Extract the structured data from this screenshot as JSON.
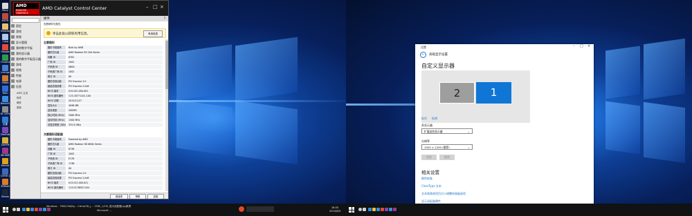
{
  "desktop": {
    "icons": [
      {
        "label": "Recy",
        "color": "#d9d9d9"
      },
      {
        "label": "MSTR",
        "color": "#c04a3a"
      },
      {
        "label": "Desktop",
        "color": "#e6c36a"
      },
      {
        "label": "1.jpg",
        "color": "#b0c8e8"
      },
      {
        "label": "Google",
        "color": "#e24a3b"
      },
      {
        "label": "Chrome",
        "color": "#2f9b4a"
      },
      {
        "label": "Livings",
        "color": "#4a7fd1"
      },
      {
        "label": "Video",
        "color": "#d37a2d"
      },
      {
        "label": "YoKu",
        "color": "#2f6fd0"
      },
      {
        "label": "BaiduYun",
        "color": "#3a8fe0"
      },
      {
        "label": "Kt 10Px",
        "color": "#909090"
      },
      {
        "label": "迅雷",
        "color": "#2e7fd6"
      },
      {
        "label": "DesPub",
        "color": "#7c4ab8"
      },
      {
        "label": "ZoeYM",
        "color": "#d6b23a"
      },
      {
        "label": "WinRAR",
        "color": "#9c3a8a"
      },
      {
        "label": "Marvel",
        "color": "#e0a020"
      },
      {
        "label": "CEFW 2015",
        "color": "#3a6ab8"
      },
      {
        "label": "3DMark",
        "color": "#e07a20"
      },
      {
        "label": "Steam",
        "color": "#1b2838"
      }
    ]
  },
  "amd": {
    "title": "AMD Catalyst Control Center",
    "logo_top": "AMD",
    "logo_sub": "RADEON GRAPHICS",
    "search_placeholder": "",
    "nav": [
      "固定",
      "游戏",
      "视频",
      "显卡管理",
      "我的数字平板",
      "我的显示器",
      "我的数字平板显示器",
      "游戏",
      "视频",
      "性能",
      "电源",
      "信息"
    ],
    "nav_sub": [
      "AMD 主页",
      "软件",
      "硬件",
      "更新"
    ],
    "header": "硬件",
    "hint": "查看硬件的属性",
    "warning": "单击此处以获取有用信息。",
    "warning_button": "有用信息",
    "section1": "主要图形",
    "table1": [
      {
        "k": "图形卡制造商",
        "v": "Built by AMD"
      },
      {
        "k": "图形芯片组",
        "v": "AMD Radeon R9 200 Series"
      },
      {
        "k": "设备 ID",
        "v": "6781"
      },
      {
        "k": "厂商 ID",
        "v": "1002"
      },
      {
        "k": "子系统 ID",
        "v": "0B00"
      },
      {
        "k": "子系统厂商 ID",
        "v": "1002"
      },
      {
        "k": "修订 ID",
        "v": "00"
      },
      {
        "k": "图形总线功能",
        "v": "PCI Express 3.0"
      },
      {
        "k": "最高总线设置",
        "v": "PCI Express 2.0x8"
      },
      {
        "k": "BIOS 版本",
        "v": "015.041.000.001"
      },
      {
        "k": "BIOS 部件编号",
        "v": "113-C6771101-100"
      },
      {
        "k": "BIOS 日期",
        "v": "2013/11/27"
      },
      {
        "k": "显存大小",
        "v": "4096 MB"
      },
      {
        "k": "显存类型",
        "v": "GDDR5"
      },
      {
        "k": "核心时钟 (MHz)",
        "v": "1080 MHz"
      },
      {
        "k": "显存时钟 (MHz)",
        "v": "1300 MHz"
      },
      {
        "k": "总显存带宽 (GB/s)",
        "v": "332.8 GB/s"
      }
    ],
    "section2": "次要图形适配器",
    "table2": [
      {
        "k": "图形卡制造商",
        "v": "Powered by AMD"
      },
      {
        "k": "图形芯片组",
        "v": "AMD Radeon HD 6800 Series"
      },
      {
        "k": "设备 ID",
        "v": "6738"
      },
      {
        "k": "厂商 ID",
        "v": "1002"
      },
      {
        "k": "子系统 ID",
        "v": "E178"
      },
      {
        "k": "子系统厂商 ID",
        "v": "174B"
      },
      {
        "k": "修订 ID",
        "v": "00"
      },
      {
        "k": "图形总线功能",
        "v": "PCI Express 2.0"
      },
      {
        "k": "最高总线设置",
        "v": "PCI Express 2.0x8"
      },
      {
        "k": "BIOS 版本",
        "v": "013.012.000.021"
      },
      {
        "k": "BIOS 部件编号",
        "v": "113-E178E0T-O04"
      }
    ],
    "footer_buttons": [
      "首选项",
      "帮助",
      "复制"
    ]
  },
  "settings": {
    "window_title": "设置",
    "page_title": "自定义显示器",
    "back_label": "←",
    "header": "高级显示设置",
    "monitor_left": "2",
    "monitor_right": "1",
    "identify_link": "标识",
    "detect_link": "检测",
    "multi_label": "多显示器",
    "multi_value": "扩展这些显示器",
    "res_label": "分辨率",
    "res_value": "1920 × 1200 (推荐)",
    "apply": "应用",
    "cancel": "取消",
    "related_title": "相关设置",
    "related_links": [
      "颜色校准",
      "ClearType 文本",
      "文本和其他项目大小调整的高级选项",
      "显示适配器属性"
    ]
  },
  "taskbar": {
    "left_items": [
      "Windows",
      "FB6/13b(fig...",
      "C#eo(3D_j...",
      "1360_1/23/...",
      "显示适配器.jpg",
      "录屏"
    ],
    "left_sub": "Microsoft ...",
    "clock_time": "18:55",
    "clock_date": "2015/8/3",
    "apps": [
      {
        "name": "start",
        "color": "#ffffff"
      },
      {
        "name": "search",
        "color": "#cfd3d8"
      },
      {
        "name": "task-view",
        "color": "#cfd3d8"
      },
      {
        "name": "edge",
        "color": "#3a8de0"
      },
      {
        "name": "explorer",
        "color": "#e8c24a"
      },
      {
        "name": "store",
        "color": "#3a8de0"
      },
      {
        "name": "chrome",
        "color": "#e24a3b"
      },
      {
        "name": "media",
        "color": "#7c4ab8"
      },
      {
        "name": "photos",
        "color": "#3a8de0"
      },
      {
        "name": "app",
        "color": "#9c3a8a"
      }
    ]
  }
}
